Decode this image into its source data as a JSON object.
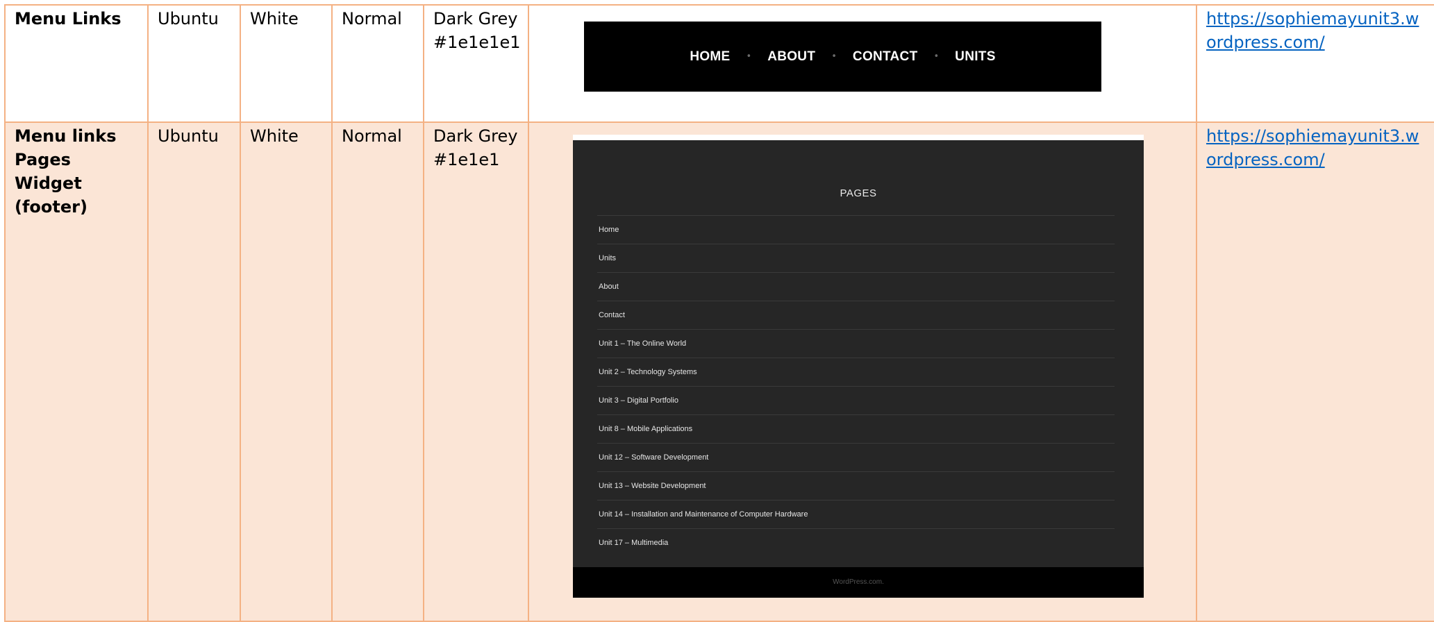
{
  "rows": [
    {
      "element": "Menu Links",
      "font": "Ubuntu",
      "colour": "White",
      "weight": "Normal",
      "background": "Dark Grey #1e1e1e1",
      "link": "https://sophiemayunit3.wordpress.com/"
    },
    {
      "element": "Menu links Pages Widget (footer)",
      "font": "Ubuntu",
      "colour": "White",
      "weight": "Normal",
      "background": "Dark Grey #1e1e1",
      "link": "https://sophiemayunit3.wordpress.com/"
    }
  ],
  "navbar": {
    "items": [
      "HOME",
      "ABOUT",
      "CONTACT",
      "UNITS"
    ],
    "separator": "•"
  },
  "widget": {
    "title": "PAGES",
    "items": [
      "Home",
      "Units",
      "About",
      "Contact",
      "Unit 1 – The Online World",
      "Unit 2 – Technology Systems",
      "Unit 3 – Digital Portfolio",
      "Unit 8 – Mobile Applications",
      "Unit 12 – Software Development",
      "Unit 13 – Website Development",
      "Unit 14 – Installation and Maintenance of Computer Hardware",
      "Unit 17 – Multimedia"
    ],
    "footer": "WordPress.com."
  },
  "colors": {
    "table_border": "#f4b183",
    "row_shade": "#fbe5d6",
    "link": "#0563c1",
    "widget_bg": "#262626"
  }
}
